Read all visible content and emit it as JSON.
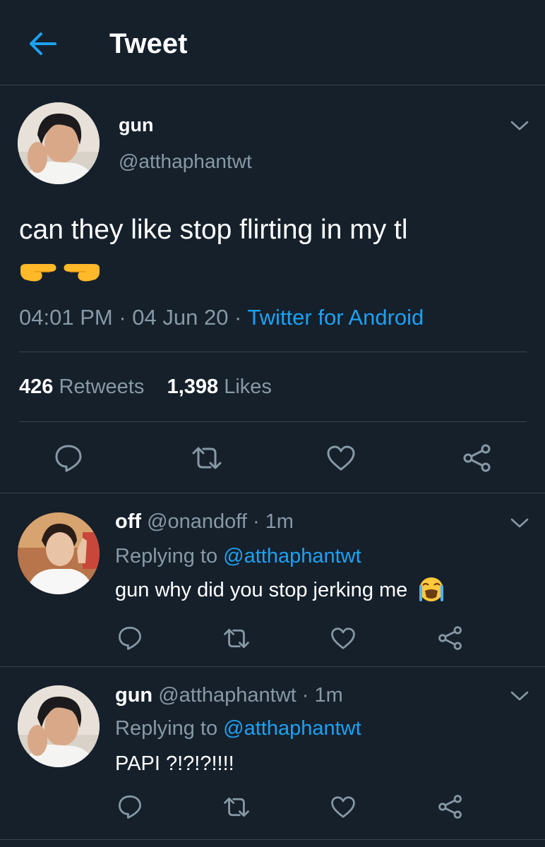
{
  "header": {
    "title": "Tweet",
    "back_icon": "arrow-left-icon"
  },
  "main_tweet": {
    "name": "gun",
    "handle": "@atthaphantwt",
    "text": "can they like stop flirting in my tl",
    "emojis": [
      "finger-pointing-right-emoji",
      "finger-pointing-left-emoji"
    ],
    "time": "04:01 PM",
    "sep1": " · ",
    "date": "04 Jun 20",
    "sep2": " · ",
    "source": "Twitter for Android",
    "retweets_count": "426",
    "retweets_label": "Retweets",
    "likes_count": "1,398",
    "likes_label": "Likes"
  },
  "replies": [
    {
      "name": "off",
      "meta": "@onandoff · 1m",
      "replying_prefix": "Replying to ",
      "replying_to": "@atthaphantwt",
      "text": "gun why did you stop jerking me",
      "emoji": "loudly-crying-face-emoji"
    },
    {
      "name": "gun",
      "meta": "@atthaphantwt · 1m",
      "replying_prefix": "Replying to ",
      "replying_to": "@atthaphantwt",
      "text": "PAPI ?!?!?!!!!"
    }
  ],
  "colors": {
    "background": "#15202b",
    "accent": "#1da1f2",
    "muted": "#8899a6",
    "divider": "#38444d"
  }
}
